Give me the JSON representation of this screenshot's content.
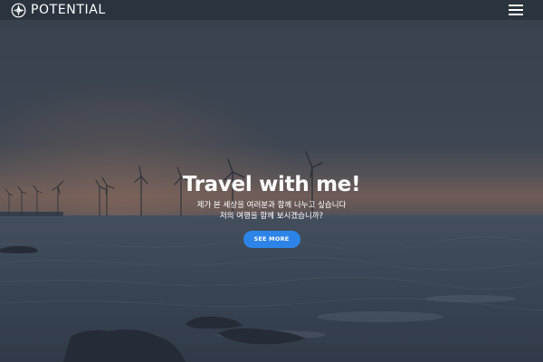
{
  "navbar": {
    "brand_name": "POTENTIAL",
    "logo_icon": "compass-icon",
    "menu_icon": "hamburger-menu-icon"
  },
  "hero": {
    "title": "Travel with me!",
    "subtitle_line1": "제가 본 세상을 여러분과 함께 나누고 싶습니다",
    "subtitle_line2": "저의 여행을 함께 보시겠습니까?",
    "cta_label": "SEE MORE"
  },
  "colors": {
    "cta_background": "#2d84e8",
    "text": "#ffffff",
    "sky_top": "#3b4653",
    "horizon_glow": "#8a6a5a",
    "sea": "#3a4757"
  }
}
